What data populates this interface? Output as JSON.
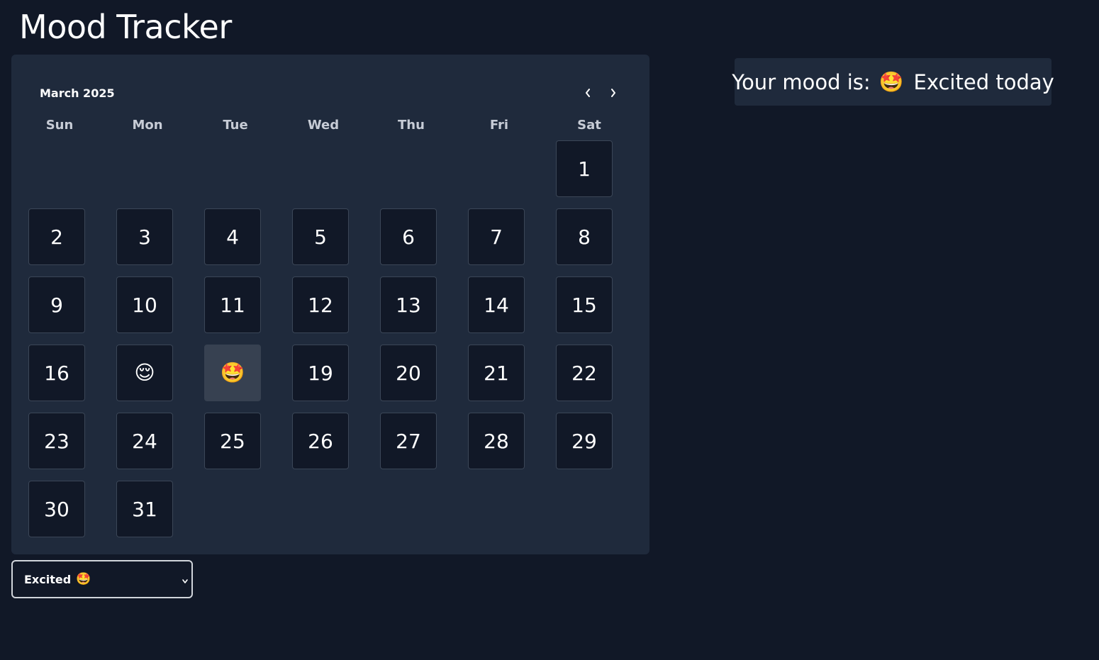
{
  "app": {
    "title": "Mood Tracker"
  },
  "calendar": {
    "month_label": "March 2025",
    "weekdays": [
      "Sun",
      "Mon",
      "Tue",
      "Wed",
      "Thu",
      "Fri",
      "Sat"
    ],
    "first_weekday_index": 6,
    "days": [
      {
        "label": "1"
      },
      {
        "label": "2"
      },
      {
        "label": "3"
      },
      {
        "label": "4"
      },
      {
        "label": "5"
      },
      {
        "label": "6"
      },
      {
        "label": "7"
      },
      {
        "label": "8"
      },
      {
        "label": "9"
      },
      {
        "label": "10"
      },
      {
        "label": "11"
      },
      {
        "label": "12"
      },
      {
        "label": "13"
      },
      {
        "label": "14"
      },
      {
        "label": "15"
      },
      {
        "label": "16"
      },
      {
        "label": "😌",
        "mood": "relieved"
      },
      {
        "label": "🤩",
        "mood": "excited",
        "selected": true
      },
      {
        "label": "19"
      },
      {
        "label": "20"
      },
      {
        "label": "21"
      },
      {
        "label": "22"
      },
      {
        "label": "23"
      },
      {
        "label": "24"
      },
      {
        "label": "25"
      },
      {
        "label": "26"
      },
      {
        "label": "27"
      },
      {
        "label": "28"
      },
      {
        "label": "29"
      },
      {
        "label": "30"
      },
      {
        "label": "31"
      }
    ],
    "prev_icon": "chevron-left-icon",
    "next_icon": "chevron-right-icon"
  },
  "mood_banner": {
    "prefix": "Your mood is:",
    "emoji": "🤩",
    "suffix": "Excited today"
  },
  "mood_select": {
    "selected_label": "Excited",
    "selected_emoji": "🤩",
    "icon": "chevron-down-icon"
  },
  "colors": {
    "background": "#111827",
    "card": "#1f2a3c",
    "cell_border": "#3b4657",
    "selected_cell": "#374151"
  }
}
